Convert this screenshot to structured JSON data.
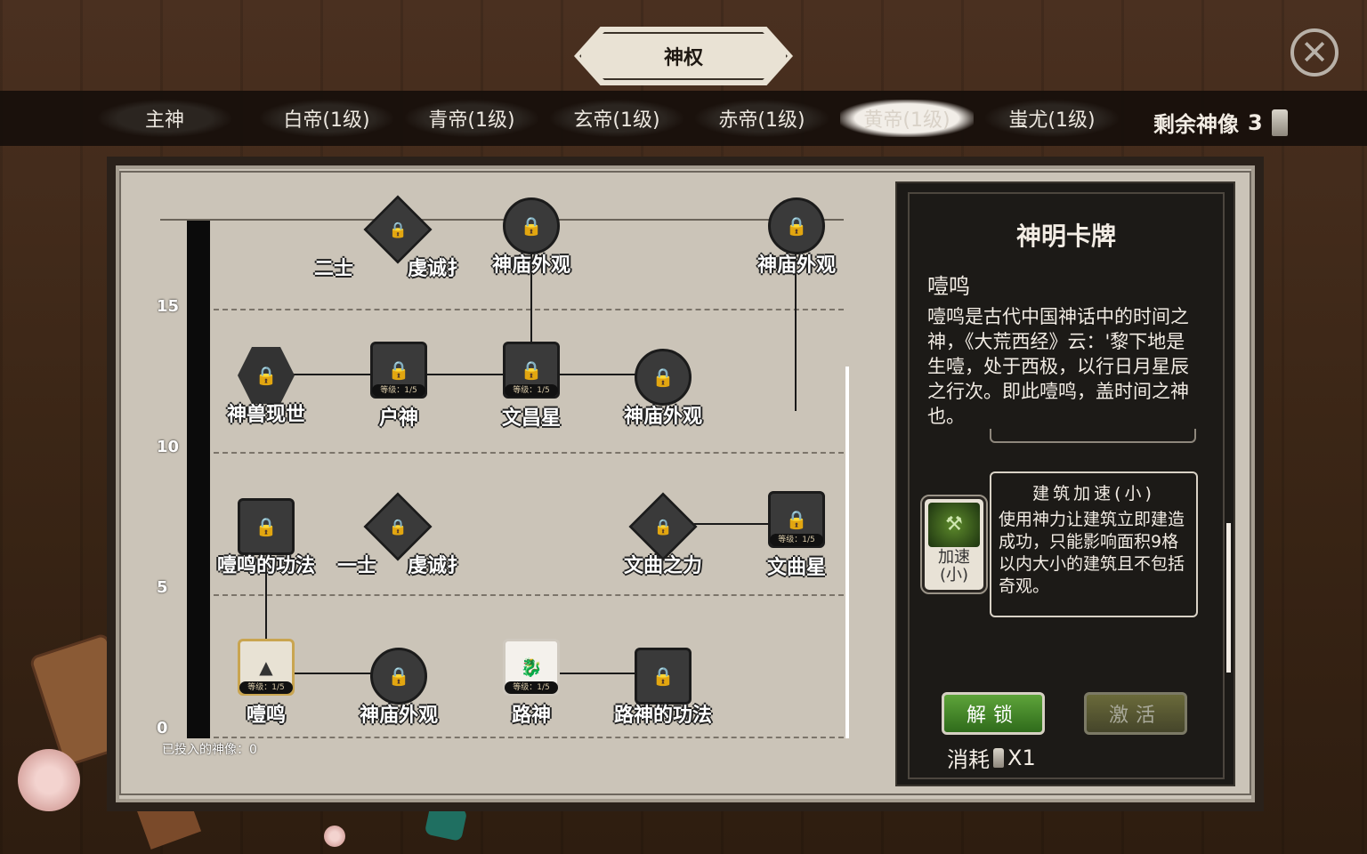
{
  "header": {
    "title": "神权",
    "close_icon": "close-icon"
  },
  "tabs": [
    {
      "label": "主神",
      "active": false
    },
    {
      "label": "白帝(1级)",
      "active": false
    },
    {
      "label": "青帝(1级)",
      "active": false
    },
    {
      "label": "玄帝(1级)",
      "active": false
    },
    {
      "label": "赤帝(1级)",
      "active": false
    },
    {
      "label": "黄帝(1级)",
      "active": true
    },
    {
      "label": "蚩尤(1级)",
      "active": false
    }
  ],
  "remaining": {
    "label": "剩余神像",
    "count": "3"
  },
  "tree": {
    "y_ticks": [
      "15",
      "10",
      "5",
      "0"
    ],
    "invested": "已投入的神像：0",
    "nodes": [
      {
        "label": "二士",
        "status": "locked"
      },
      {
        "label": "虔诚扌",
        "status": "locked"
      },
      {
        "label": "神庙外观",
        "status": "locked"
      },
      {
        "label": "神庙外观",
        "status": "locked"
      },
      {
        "label": "神兽现世",
        "status": "locked"
      },
      {
        "label": "户神",
        "status": "locked",
        "level": "等级：1/5"
      },
      {
        "label": "文昌星",
        "status": "locked",
        "level": "等级：1/5"
      },
      {
        "label": "神庙外观",
        "status": "locked"
      },
      {
        "label": "噎鸣的功法",
        "status": "locked"
      },
      {
        "label": "一士",
        "status": "locked"
      },
      {
        "label": "虔诚扌",
        "status": "locked"
      },
      {
        "label": "文曲之力",
        "status": "locked"
      },
      {
        "label": "文曲星",
        "status": "locked",
        "level": "等级：1/5"
      },
      {
        "label": "噎鸣",
        "status": "selected",
        "level": "等级：1/5"
      },
      {
        "label": "神庙外观",
        "status": "locked"
      },
      {
        "label": "路神",
        "status": "unlocked",
        "level": "等级：1/5"
      },
      {
        "label": "路神的功法",
        "status": "locked"
      }
    ]
  },
  "card": {
    "title": "神明卡牌",
    "name": "噎鸣",
    "description": "噎鸣是古代中国神话中的时间之神，《大荒西经》云：'黎下地是生噎，处于西极，以行日月星辰之行次。即此噎鸣，盖时间之神也。",
    "skill": {
      "icon_label_1": "加速",
      "icon_label_2": "(小)",
      "name": "建筑加速(小)",
      "description": "使用神力让建筑立即建造成功，只能影响面积9格以内大小的建筑且不包括奇观。"
    },
    "unlock_label": "解锁",
    "activate_label": "激活",
    "cost_label": "消耗",
    "cost_value": "X1"
  },
  "colors": {
    "accent_green": "#4a8f2a",
    "panel_dark": "#1c1a17",
    "board": "#cbc4b8"
  }
}
